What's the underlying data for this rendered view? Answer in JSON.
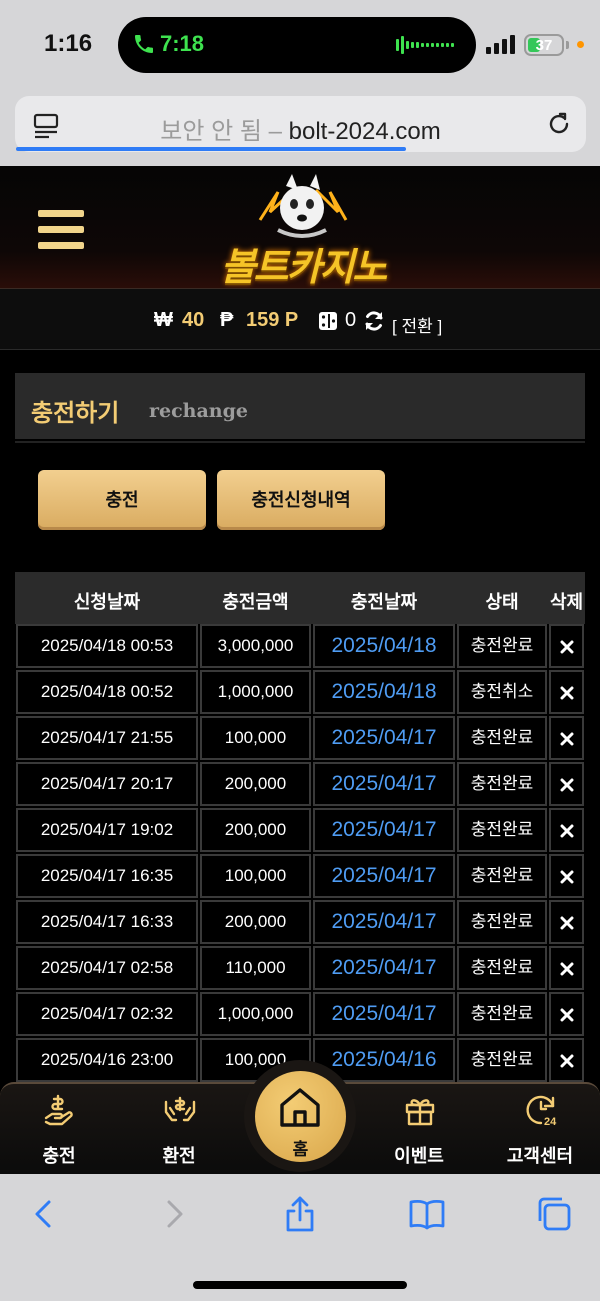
{
  "status_bar": {
    "time": "1:16",
    "call_time": "7:18",
    "battery": "37",
    "battery_level": 0.37
  },
  "browser": {
    "insecure_label": "보안 안 됨 –",
    "domain": "bolt-2024.com"
  },
  "site": {
    "logo_text": "볼트카지노"
  },
  "balance": {
    "won_symbol": "₩",
    "won": "40",
    "point_symbol": "₱",
    "points": "159 P",
    "chips": "0",
    "switch_label": "[ 전환 ]"
  },
  "page": {
    "title": "충전하기",
    "subtitle": "rechange"
  },
  "actions": {
    "recharge": "충전",
    "history": "충전신청내역"
  },
  "table": {
    "headers": [
      "신청날짜",
      "충전금액",
      "충전날짜",
      "상태",
      "삭제"
    ],
    "rows": [
      {
        "requested": "2025/04/18 00:53",
        "amount": "3,000,000",
        "date": "2025/04/18",
        "status": "충전완료"
      },
      {
        "requested": "2025/04/18 00:52",
        "amount": "1,000,000",
        "date": "2025/04/18",
        "status": "충전취소"
      },
      {
        "requested": "2025/04/17 21:55",
        "amount": "100,000",
        "date": "2025/04/17",
        "status": "충전완료"
      },
      {
        "requested": "2025/04/17 20:17",
        "amount": "200,000",
        "date": "2025/04/17",
        "status": "충전완료"
      },
      {
        "requested": "2025/04/17 19:02",
        "amount": "200,000",
        "date": "2025/04/17",
        "status": "충전완료"
      },
      {
        "requested": "2025/04/17 16:35",
        "amount": "100,000",
        "date": "2025/04/17",
        "status": "충전완료"
      },
      {
        "requested": "2025/04/17 16:33",
        "amount": "200,000",
        "date": "2025/04/17",
        "status": "충전완료"
      },
      {
        "requested": "2025/04/17 02:58",
        "amount": "110,000",
        "date": "2025/04/17",
        "status": "충전완료"
      },
      {
        "requested": "2025/04/17 02:32",
        "amount": "1,000,000",
        "date": "2025/04/17",
        "status": "충전완료"
      },
      {
        "requested": "2025/04/16 23:00",
        "amount": "100,000",
        "date": "2025/04/16",
        "status": "충전완료"
      }
    ]
  },
  "tabbar": {
    "recharge": "충전",
    "exchange": "환전",
    "home": "홈",
    "event": "이벤트",
    "support": "고객센터"
  },
  "colors": {
    "gold": "#f3cc74",
    "link_blue": "#4f9cf3",
    "background": "#000000"
  }
}
